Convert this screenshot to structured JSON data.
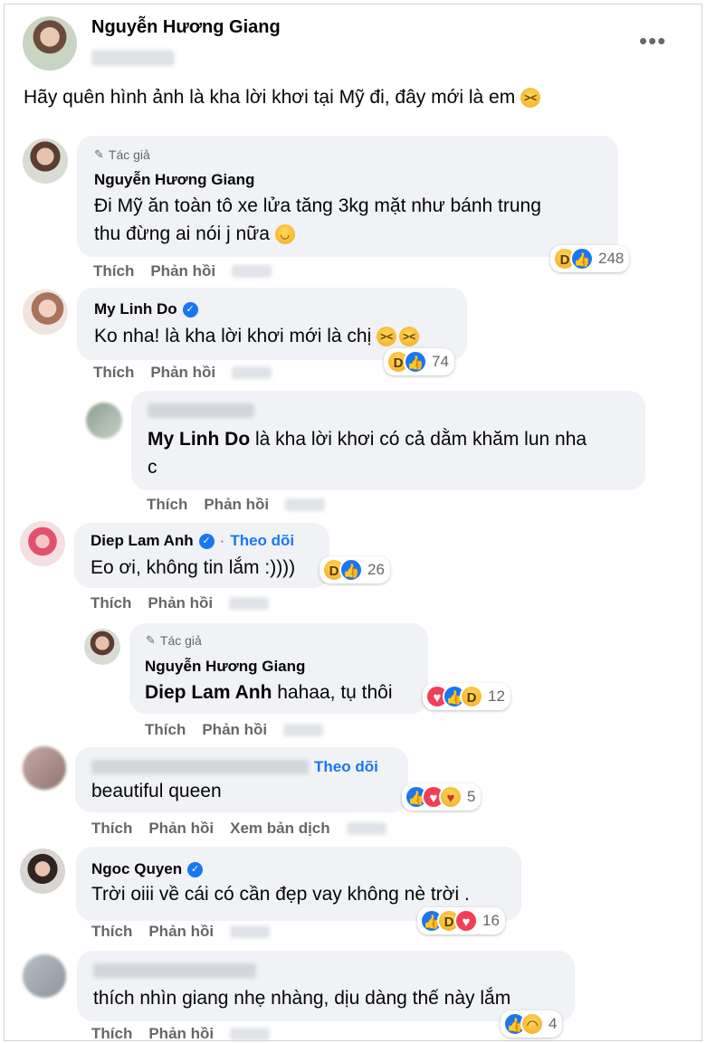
{
  "post": {
    "author": "Nguyễn Hương Giang",
    "text": "Hãy quên hình ảnh là kha lời khơi tại Mỹ đi, đây mới là em",
    "emoji": "laughing-face",
    "more_label": "•••"
  },
  "labels": {
    "like": "Thích",
    "reply": "Phản hồi",
    "translate": "Xem bản dịch",
    "author_badge": "Tác giả",
    "follow": "Theo dõi",
    "dot": "·"
  },
  "comments": [
    {
      "author_badge": true,
      "name": "Nguyễn Hương Giang",
      "lines": [
        "Đi Mỹ ăn toàn tô xe lửa tăng 3kg mặt như bánh trung",
        "thu đừng ai nói j nữa"
      ],
      "emoji": "relieved-face",
      "reactions": [
        "haha",
        "like"
      ],
      "count": "248"
    },
    {
      "name": "My Linh Do",
      "verified": true,
      "text": "Ko nha! là kha lời khơi mới là chị",
      "emoji": "laughing-face x2",
      "reactions": [
        "haha",
        "like"
      ],
      "count": "74"
    },
    {
      "reply": true,
      "tag": "My Linh Do",
      "lines": [
        "là kha lời khơi có cả dằm khăm lun nha",
        "c"
      ]
    },
    {
      "name": "Diep Lam Anh",
      "verified": true,
      "follow": true,
      "text": "Eo ơi, không tin lắm :))))",
      "reactions": [
        "haha",
        "like"
      ],
      "count": "26"
    },
    {
      "reply": true,
      "author_badge": true,
      "name": "Nguyễn Hương Giang",
      "tag": "Diep Lam Anh",
      "text": "hahaa, tụ thôi",
      "reactions": [
        "love",
        "like",
        "haha"
      ],
      "count": "12"
    },
    {
      "follow": true,
      "text": "beautiful queen",
      "reactions": [
        "like",
        "love",
        "care"
      ],
      "count": "5",
      "translate": true
    },
    {
      "name": "Ngoc Quyen",
      "verified": true,
      "text": "Trời oiii về cái có cần đẹp vay không nè trời .",
      "reactions": [
        "like",
        "haha",
        "love"
      ],
      "count": "16"
    },
    {
      "text": "thích nhìn giang nhẹ nhàng, dịu dàng thế này lắm",
      "reactions": [
        "like",
        "sad"
      ],
      "count": "4"
    }
  ],
  "colors": {
    "bubble": "#f0f2f5",
    "link_blue": "#1877f2",
    "secondary_text": "#65676b"
  }
}
